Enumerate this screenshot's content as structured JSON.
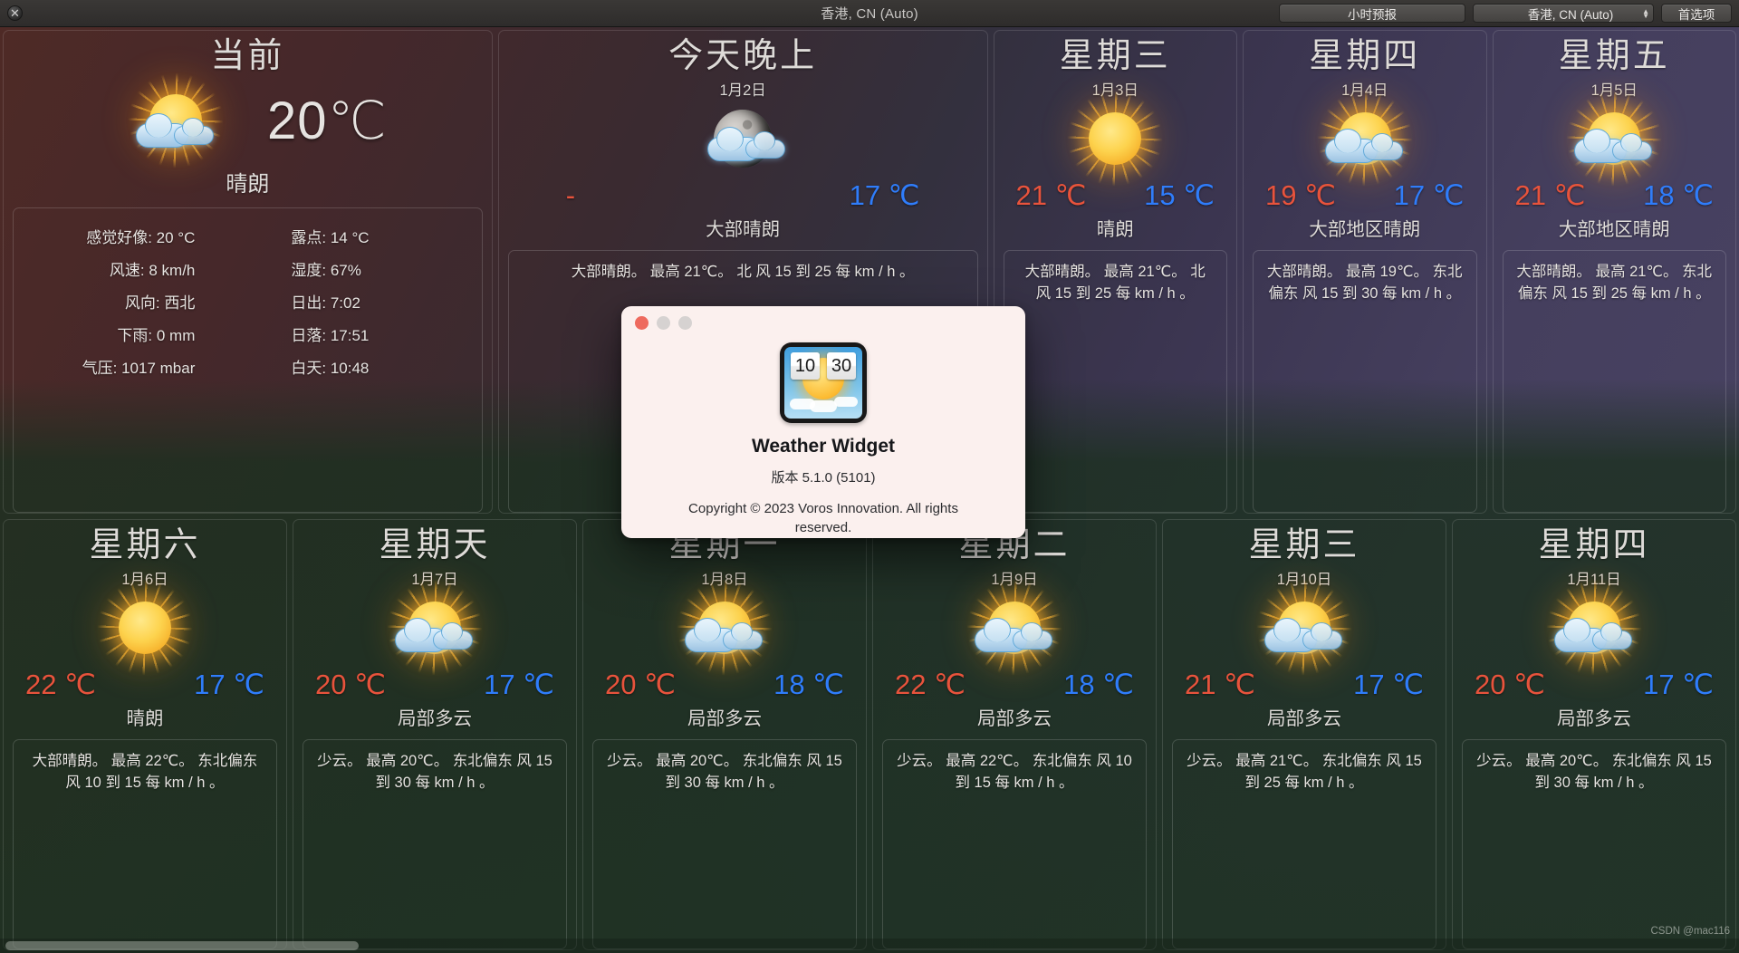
{
  "titlebar": {
    "close_icon": "close-icon",
    "title": "香港, CN (Auto)",
    "hourly_button": "小时预报",
    "location_popup": "香港, CN (Auto)",
    "prefs_button": "首选项"
  },
  "current": {
    "heading": "当前",
    "icon": "sun-behind-cloud-icon",
    "temperature": "20℃",
    "condition": "晴朗",
    "metrics": [
      {
        "label": "感觉好像: 20 °C",
        "label2": "露点: 14 °C"
      },
      {
        "label": "风速: 8 km/h",
        "label2": "湿度: 67%"
      },
      {
        "label": "风向: 西北",
        "label2": "日出: 7:02"
      },
      {
        "label": "下雨: 0 mm",
        "label2": "日落: 17:51"
      },
      {
        "label": "气压: 1017 mbar",
        "label2": "白天: 10:48"
      }
    ]
  },
  "forecast": [
    {
      "name": "今天晚上",
      "date": "1月2日",
      "icon": "moon-behind-cloud-icon",
      "hi": "-",
      "lo": "17 ℃",
      "condition": "大部晴朗",
      "description": "大部晴朗。 最高 21℃。 北 风 15 到 25 每 km / h 。"
    },
    {
      "name": "星期三",
      "date": "1月3日",
      "icon": "sun-icon",
      "hi": "21 ℃",
      "lo": "15 ℃",
      "condition": "晴朗",
      "description": "大部晴朗。 最高 21℃。 北 风 15 到 25 每 km / h 。"
    },
    {
      "name": "星期四",
      "date": "1月4日",
      "icon": "sun-behind-cloud-icon",
      "hi": "19 ℃",
      "lo": "17 ℃",
      "condition": "大部地区晴朗",
      "description": "大部晴朗。 最高 19℃。 东北偏东 风 15 到 30 每 km / h 。"
    },
    {
      "name": "星期五",
      "date": "1月5日",
      "icon": "sun-behind-cloud-icon",
      "hi": "21 ℃",
      "lo": "18 ℃",
      "condition": "大部地区晴朗",
      "description": "大部晴朗。 最高 21℃。 东北偏东 风 15 到 25 每 km / h 。"
    },
    {
      "name": "星期六",
      "date": "1月6日",
      "icon": "sun-icon",
      "hi": "22 ℃",
      "lo": "17 ℃",
      "condition": "晴朗",
      "description": "大部晴朗。 最高 22℃。 东北偏东 风 10 到 15 每 km / h 。"
    },
    {
      "name": "星期天",
      "date": "1月7日",
      "icon": "sun-behind-cloud-icon",
      "hi": "20 ℃",
      "lo": "17 ℃",
      "condition": "局部多云",
      "description": "少云。 最高 20℃。 东北偏东 风 15 到 30 每 km / h 。"
    },
    {
      "name": "星期一",
      "date": "1月8日",
      "icon": "sun-behind-cloud-icon",
      "hi": "20 ℃",
      "lo": "18 ℃",
      "condition": "局部多云",
      "description": "少云。 最高 20℃。 东北偏东 风 15 到 30 每 km / h 。"
    },
    {
      "name": "星期二",
      "date": "1月9日",
      "icon": "sun-behind-cloud-icon",
      "hi": "22 ℃",
      "lo": "18 ℃",
      "condition": "局部多云",
      "description": "少云。 最高 22℃。 东北偏东 风 10 到 15 每 km / h 。"
    },
    {
      "name": "星期三",
      "date": "1月10日",
      "icon": "sun-behind-cloud-icon",
      "hi": "21 ℃",
      "lo": "17 ℃",
      "condition": "局部多云",
      "description": "少云。 最高 21℃。 东北偏东 风 15 到 25 每 km / h 。"
    },
    {
      "name": "星期四",
      "date": "1月11日",
      "icon": "sun-behind-cloud-icon",
      "hi": "20 ℃",
      "lo": "17 ℃",
      "condition": "局部多云",
      "description": "少云。 最高 20℃。 东北偏东 风 15 到 30 每 km / h 。"
    }
  ],
  "about": {
    "app_icon": "weather-widget-app-icon",
    "icon_hour": "10",
    "icon_minute": "30",
    "name": "Weather Widget",
    "version": "版本 5.1.0 (5101)",
    "copyright": "Copyright © 2023 Voros Innovation. All rights reserved."
  },
  "watermark": "CSDN @mac116",
  "colors": {
    "high_temp": "#e8533c",
    "low_temp": "#2f7dfb",
    "dialog_bg": "#fbf0ee"
  }
}
